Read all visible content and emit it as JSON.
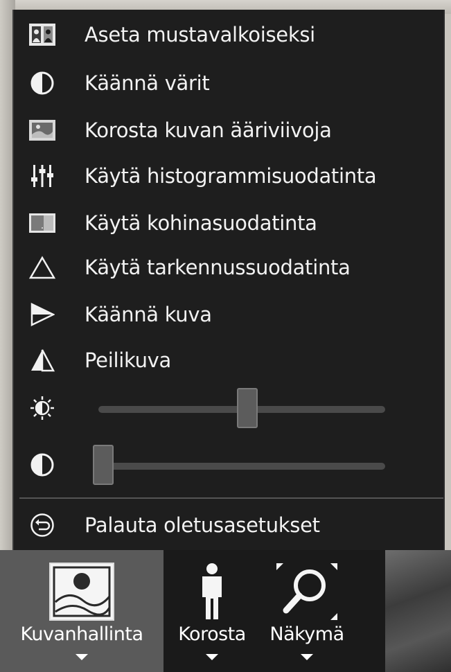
{
  "menu": {
    "items": [
      {
        "label": "Aseta mustavalkoiseksi",
        "icon": "grayscale-icon"
      },
      {
        "label": "Käännä värit",
        "icon": "invert-colors-icon"
      },
      {
        "label": "Korosta kuvan ääriviivoja",
        "icon": "edge-enhance-icon"
      },
      {
        "label": "Käytä histogrammisuodatinta",
        "icon": "histogram-sliders-icon"
      },
      {
        "label": "Käytä kohinasuodatinta",
        "icon": "noise-filter-icon"
      },
      {
        "label": "Käytä tarkennussuodatinta",
        "icon": "sharpen-triangle-icon"
      },
      {
        "label": "Käännä kuva",
        "icon": "rotate-image-icon"
      },
      {
        "label": "Peilikuva",
        "icon": "mirror-image-icon"
      }
    ],
    "brightness_level": 0.52,
    "contrast_level": 0.0,
    "reset_label": "Palauta oletusasetukset"
  },
  "toolbar": {
    "buttons": [
      {
        "label": "Kuvanhallinta",
        "icon": "image-control-icon",
        "active": true
      },
      {
        "label": "Korosta",
        "icon": "person-icon",
        "active": false
      },
      {
        "label": "Näkymä",
        "icon": "zoom-view-icon",
        "active": false
      }
    ]
  },
  "colors": {
    "menu_bg": "#1e1e1e",
    "text": "#f2f2f2",
    "active_button_bg": "#5a5a5a"
  }
}
